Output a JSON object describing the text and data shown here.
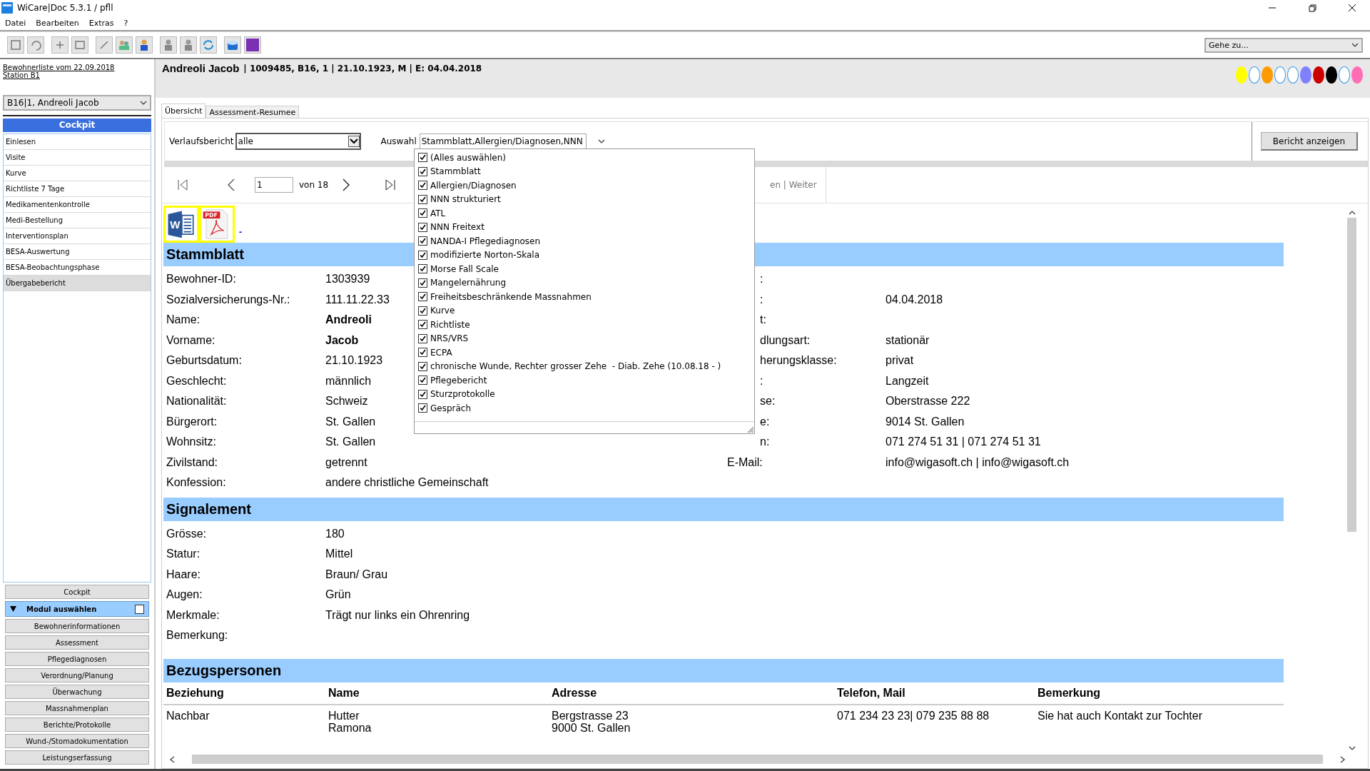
{
  "window": {
    "title": "WiCare|Doc 5.3.1  / pfll"
  },
  "menu": [
    "Datei",
    "Bearbeiten",
    "Extras",
    "?"
  ],
  "toolbar": {
    "goto": "Gehe zu..."
  },
  "sidebar": {
    "list_link": "Bewohnerliste vom 22.09.2018",
    "station_link": "Station B1",
    "resident": "B16|1, Andreoli Jacob",
    "header": "Cockpit",
    "items": [
      {
        "label": "Einlesen",
        "selected": false
      },
      {
        "label": "Visite",
        "selected": false
      },
      {
        "label": "Kurve",
        "selected": false
      },
      {
        "label": "Richtliste 7 Tage",
        "selected": false
      },
      {
        "label": "Medikamentenkontrolle",
        "selected": false
      },
      {
        "label": "Medi-Bestellung",
        "selected": false
      },
      {
        "label": "Interventionsplan",
        "selected": false
      },
      {
        "label": "BESA-Auswertung",
        "selected": false
      },
      {
        "label": "BESA-Beobachtungsphase",
        "selected": false
      },
      {
        "label": "Übergabebericht",
        "selected": true
      }
    ],
    "cockpit_button": "Cockpit",
    "module_header": {
      "label": "Modul auswählen",
      "expanded": true,
      "checked": false
    },
    "modules": [
      "Bewohnerinformationen",
      "Assessment",
      "Pflegediagnosen",
      "Verordnung/Planung",
      "Überwachung",
      "Massnahmenplan",
      "Berichte/Protokolle",
      "Wund-/Stomadokumentation",
      "Leistungserfassung"
    ]
  },
  "header": {
    "name": "Andreoli Jacob",
    "details": "| 1009485, B16, 1 | 21.10.1923, M | E: 04.04.2018",
    "dots": [
      {
        "color": "#ffff00"
      },
      {
        "color": "#ffffff"
      },
      {
        "color": "#ff9900"
      },
      {
        "color": "#ffffff"
      },
      {
        "color": "#ffffff"
      },
      {
        "color": "#8080ff"
      },
      {
        "color": "#cc0000"
      },
      {
        "color": "#000000"
      },
      {
        "color": "#ffffff"
      },
      {
        "color": "#ff6eb4"
      }
    ]
  },
  "tabs": [
    {
      "label": "Übersicht",
      "selected": true
    },
    {
      "label": "Assessment-Resumee",
      "selected": false
    }
  ],
  "filter": {
    "report_label": "Verlaufsbericht",
    "report_value": "alle",
    "selection_label": "Auswahl",
    "selection_value": "Stammblatt,Allergien/Diagnosen,NNN",
    "button": "Bericht anzeigen",
    "options": [
      {
        "label": "(Alles auswählen)",
        "checked": true
      },
      {
        "label": "Stammblatt",
        "checked": true
      },
      {
        "label": "Allergien/Diagnosen",
        "checked": true
      },
      {
        "label": "NNN strukturiert",
        "checked": true
      },
      {
        "label": "ATL",
        "checked": true
      },
      {
        "label": "NNN Freitext",
        "checked": true
      },
      {
        "label": "NANDA-I Pflegediagnosen",
        "checked": true
      },
      {
        "label": "modifizierte Norton-Skala",
        "checked": true
      },
      {
        "label": "Morse Fall Scale",
        "checked": true
      },
      {
        "label": "Mangelernährung",
        "checked": true
      },
      {
        "label": "Freiheitsbeschränkende Massnahmen",
        "checked": true
      },
      {
        "label": "Kurve",
        "checked": true
      },
      {
        "label": "Richtliste",
        "checked": true
      },
      {
        "label": "NRS/VRS",
        "checked": true
      },
      {
        "label": "ECPA",
        "checked": true
      },
      {
        "label": "chronische Wunde, Rechter grosser Zehe  - Diab. Zehe (10.08.18 - )",
        "checked": true
      },
      {
        "label": "Pflegebericht",
        "checked": true
      },
      {
        "label": "Sturzprotokolle",
        "checked": true
      },
      {
        "label": "Gespräch",
        "checked": true
      }
    ]
  },
  "pager": {
    "page": "1",
    "of": "von 18",
    "links": "en | Weiter"
  },
  "exports": [
    {
      "kind": "word",
      "label": "W"
    },
    {
      "kind": "pdf",
      "label": "PDF"
    }
  ],
  "export_link": "-",
  "stammblatt": {
    "title": "Stammblatt",
    "left": [
      {
        "label": "Bewohner-ID:",
        "value": "1303939",
        "bold": false
      },
      {
        "label": "Sozialversicherungs-Nr.:",
        "value": "111.11.22.33",
        "bold": false
      },
      {
        "label": "Name:",
        "value": "Andreoli",
        "bold": true
      },
      {
        "label": "Vorname:",
        "value": "Jacob",
        "bold": true
      },
      {
        "label": "Geburtsdatum:",
        "value": "21.10.1923",
        "bold": false
      },
      {
        "label": "Geschlecht:",
        "value": "männlich",
        "bold": false
      },
      {
        "label": "Nationalität:",
        "value": "Schweiz",
        "bold": false
      },
      {
        "label": "Bürgerort:",
        "value": "St. Gallen",
        "bold": false
      },
      {
        "label": "Wohnsitz:",
        "value": "St. Gallen",
        "bold": false
      },
      {
        "label": "Zivilstand:",
        "value": "getrennt",
        "bold": false
      },
      {
        "label": "Konfession:",
        "value": "andere christliche Gemeinschaft",
        "bold": false
      }
    ],
    "right": [
      {
        "label": ":",
        "partly_hidden": true
      },
      {
        "label": ":",
        "value": "04.04.2018",
        "partly_hidden": true
      },
      {
        "label": "t:",
        "partly_hidden": true
      },
      {
        "label": "dlungsart:",
        "value": "stationär",
        "partly_hidden": true
      },
      {
        "label": "herungsklasse:",
        "value": "privat",
        "partly_hidden": true
      },
      {
        "label": ":",
        "value": "Langzeit",
        "partly_hidden": true
      },
      {
        "label": "se:",
        "value": "Oberstrasse 222",
        "partly_hidden": true
      },
      {
        "label": "e:",
        "value": "9014 St. Gallen",
        "partly_hidden": true
      },
      {
        "label": "n:",
        "value": "071 274 51 31 | 071 274 51 31",
        "partly_hidden": true
      },
      {
        "label": "E-Mail:",
        "value": "info@wigasoft.ch | info@wigasoft.ch",
        "partly_hidden": false
      }
    ]
  },
  "signalement": {
    "title": "Signalement",
    "rows": [
      {
        "label": "Grösse:",
        "value": "180"
      },
      {
        "label": "Statur:",
        "value": "Mittel"
      },
      {
        "label": "Haare:",
        "value": "Braun/ Grau"
      },
      {
        "label": "Augen:",
        "value": "Grün"
      },
      {
        "label": "Merkmale:",
        "value": "Trägt nur links ein Ohrenring"
      },
      {
        "label": "Bemerkung:"
      }
    ]
  },
  "bezugspersonen": {
    "title": "Bezugspersonen",
    "columns": [
      "Beziehung",
      "Name",
      "Adresse",
      "Telefon, Mail",
      "Bemerkung"
    ],
    "rows": [
      [
        "Nachbar",
        "Hutter\nRamona",
        "Bergstrasse 23\n9000 St. Gallen",
        "071 234 23 23| 079 235 88 88",
        "Sie hat auch Kontakt zur Tochter"
      ]
    ]
  }
}
